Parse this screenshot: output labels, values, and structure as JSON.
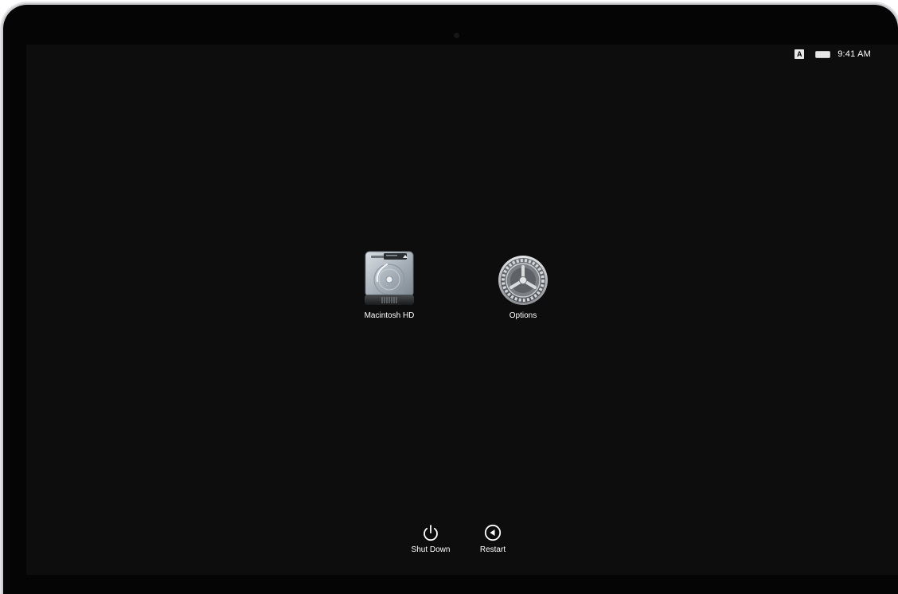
{
  "status_bar": {
    "input_source": "A",
    "battery_icon": "battery-icon",
    "time": "9:41 AM"
  },
  "boot_items": {
    "disk": {
      "label": "Macintosh HD",
      "icon": "hard-drive-icon"
    },
    "options": {
      "label": "Options",
      "icon": "gear-icon"
    }
  },
  "power_actions": {
    "shutdown": {
      "label": "Shut Down",
      "icon": "power-icon"
    },
    "restart": {
      "label": "Restart",
      "icon": "restart-icon"
    }
  },
  "colors": {
    "screen_background": "#0d0d0d",
    "text": "#ffffff",
    "bezel": "#050505"
  }
}
